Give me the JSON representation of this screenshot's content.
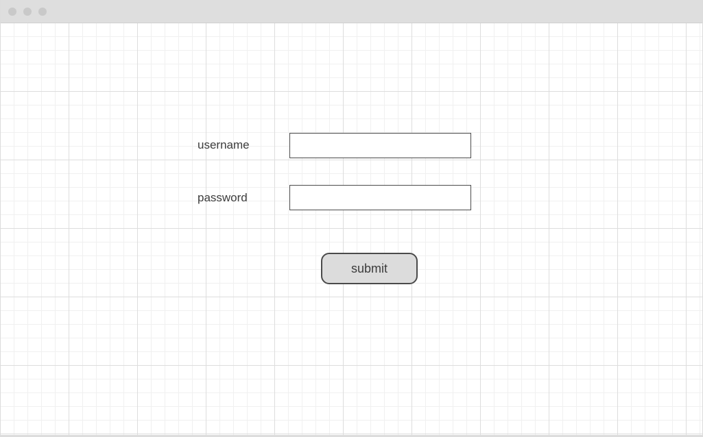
{
  "form": {
    "username_label": "username",
    "username_value": "",
    "password_label": "password",
    "password_value": "",
    "submit_label": "submit"
  },
  "colors": {
    "titlebar": "#dedede",
    "window_dot": "#c9c9c9",
    "grid_major": "#dddddd",
    "grid_minor": "#f0f0f0",
    "button_fill": "#dcdcdc",
    "border": "#4a4a4a",
    "text": "#3c3c3c"
  }
}
